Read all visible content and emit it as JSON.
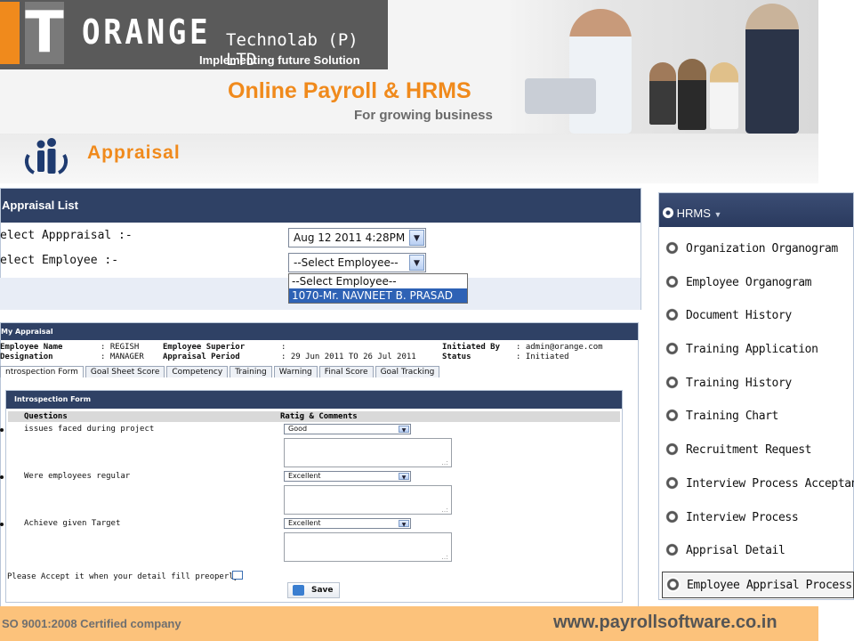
{
  "header": {
    "logo_letters": "OT",
    "logo_letter_t": "T",
    "company_name": "ORANGE",
    "company_suffix": "Technolab (P) LTD",
    "tagline": "Implementing future Solution",
    "product_title": "Online Payroll & HRMS",
    "product_subtitle": "For growing business"
  },
  "module": {
    "title": "Appraisal",
    "icon": "people-icon"
  },
  "appraisal_list": {
    "title": "Appraisal List",
    "select_appraisal_label": "Select Appraisal :-",
    "select_appraisal_label_text": "elect Apppraisal :-",
    "select_appraisal_value": "Aug 12 2011 4:28PM",
    "select_employee_label_text": "elect Employee :-",
    "select_employee_value": "--Select Employee--",
    "employee_options": [
      "--Select Employee--",
      "1070-Mr. NAVNEET B. PRASAD"
    ],
    "highlighted_option": "1070-Mr. NAVNEET B. PRASAD"
  },
  "my_appraisal": {
    "title": "My Appraisal",
    "employee_name_label": "Employee Name",
    "employee_name_value": ": REGISH",
    "designation_label": "Designation",
    "designation_value": ": MANAGER",
    "superior_label": "Employee Superior",
    "superior_value": ":",
    "period_label": "Appraisal Period",
    "period_value": ": 29 Jun 2011 TO 26 Jul 2011",
    "initiated_by_label": "Initiated By",
    "initiated_by_value": ": admin@orange.com",
    "status_label": "Status",
    "status_value": ": Initiated",
    "tabs": [
      "ntrospection Form",
      "Goal Sheet Score",
      "Competency",
      "Training",
      "Warning",
      "Final Score",
      "Goal Tracking"
    ],
    "active_tab": "ntrospection Form"
  },
  "introspection_form": {
    "title": "Introspection Form",
    "col_questions": "Questions",
    "col_rating": "Ratig & Comments",
    "questions": [
      {
        "text": "issues faced during project",
        "rating": "Good"
      },
      {
        "text": "Were employees regular",
        "rating": "Excellent"
      },
      {
        "text": "Achieve given Target",
        "rating": "Excellent"
      }
    ],
    "accept_text": "Please Accept it when your detail fill preoperly",
    "accept_checked": false,
    "save_label": "Save"
  },
  "hrms_menu": {
    "title": "HRMS",
    "items": [
      "Organization Organogram",
      "Employee Organogram",
      "Document History",
      "Training Application",
      "Training History",
      "Training Chart",
      "Recruitment Request",
      "Interview Process Acceptance",
      "Interview Process",
      "Apprisal Detail",
      "Employee Apprisal Process Data"
    ],
    "active_item": "Employee Apprisal Process Data"
  },
  "footer": {
    "certification": "SO 9001:2008 Certified company",
    "website": "www.payrollsoftware.co.in"
  },
  "colors": {
    "brand_orange": "#f08a1c",
    "panel_header_navy": "#2f4165",
    "footer_bg": "#fcc27b",
    "selection_blue": "#2e62b5"
  }
}
